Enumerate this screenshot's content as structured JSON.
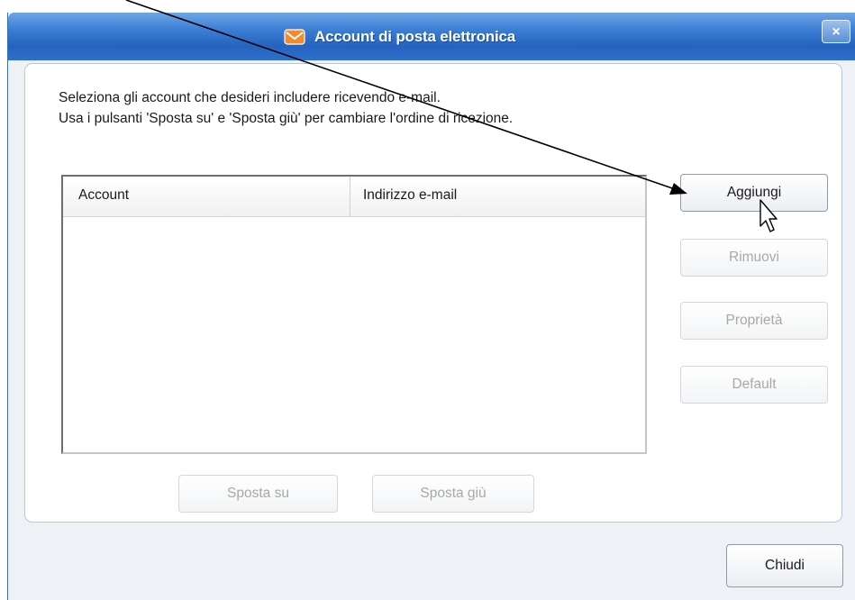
{
  "window": {
    "title": "Account di posta elettronica",
    "close_label": "×"
  },
  "description": {
    "line1": "Seleziona gli account che desideri includere ricevendo e-mail.",
    "line2": "Usa i pulsanti 'Sposta su' e 'Sposta giù' per cambiare l'ordine di ricezione."
  },
  "list": {
    "columns": [
      "Account",
      "Indirizzo e-mail"
    ],
    "rows": []
  },
  "buttons": {
    "add": "Aggiungi",
    "remove": "Rimuovi",
    "properties": "Proprietà",
    "default": "Default",
    "move_up": "Sposta su",
    "move_down": "Sposta giù",
    "close": "Chiudi"
  },
  "colors": {
    "titlebar": "#2f6fcb",
    "background": "#eef2f7",
    "disabled_text": "#a8a8a8"
  }
}
